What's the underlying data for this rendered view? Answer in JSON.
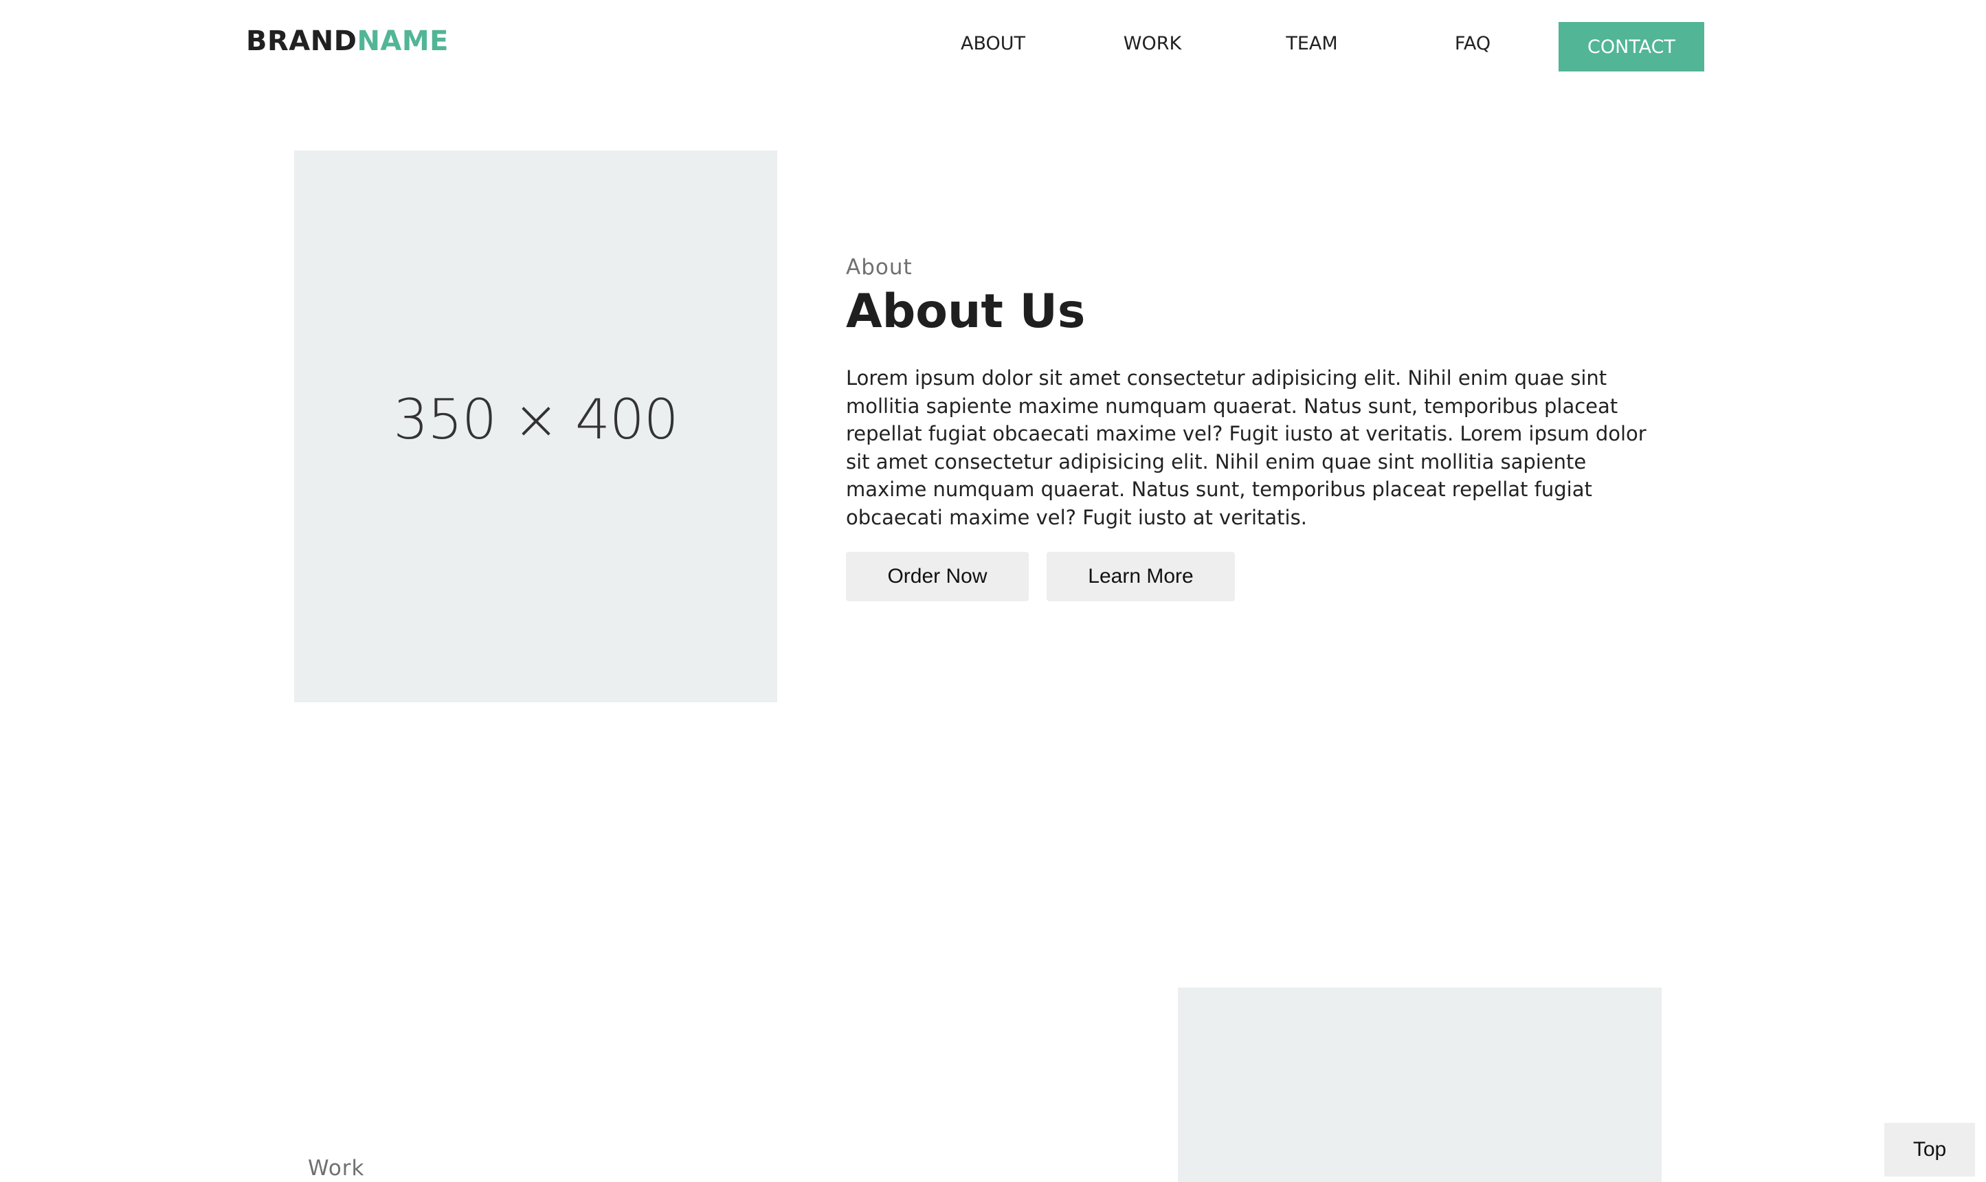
{
  "header": {
    "brand_part1": "BRAND",
    "brand_part2": "NAME",
    "nav": {
      "about": "ABOUT",
      "work": "WORK",
      "team": "TEAM",
      "faq": "FAQ",
      "contact": "CONTACT"
    }
  },
  "about": {
    "image_placeholder": "350 × 400",
    "eyebrow": "About",
    "title": "About Us",
    "body": "Lorem ipsum dolor sit amet consectetur adipisicing elit. Nihil enim quae sint mollitia sapiente maxime numquam quaerat. Natus sunt, temporibus placeat repellat fugiat obcaecati maxime vel? Fugit iusto at veritatis. Lorem ipsum dolor sit amet consectetur adipisicing elit. Nihil enim quae sint mollitia sapiente maxime numquam quaerat. Natus sunt, temporibus placeat repellat fugiat obcaecati maxime vel? Fugit iusto at veritatis.",
    "order_button": "Order Now",
    "learn_button": "Learn More"
  },
  "work": {
    "eyebrow": "Work"
  },
  "back_to_top": "Top",
  "colors": {
    "accent": "#52b596",
    "placeholder_bg": "#ecefef",
    "button_bg": "#eeeeee",
    "text": "#212121",
    "muted": "#707070"
  }
}
